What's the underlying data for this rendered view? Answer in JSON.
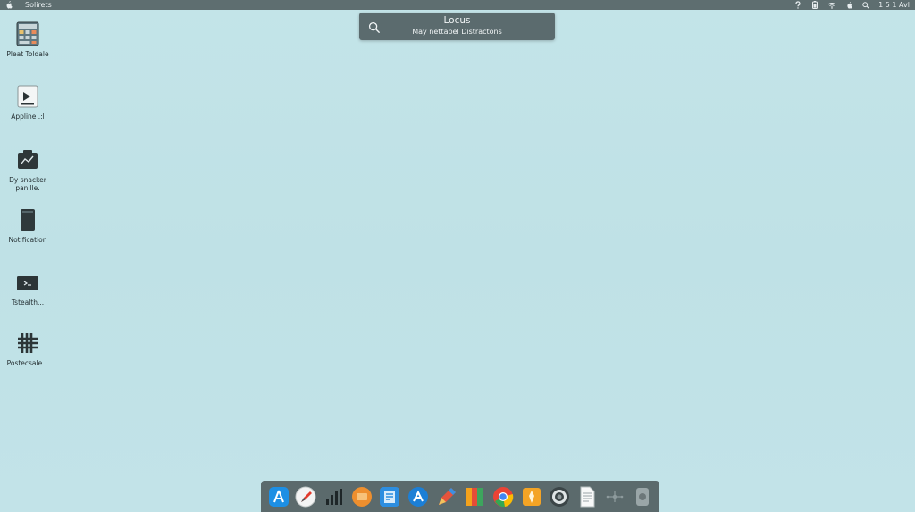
{
  "menubar": {
    "app_name": "Solirets",
    "clock": "1 5 1 Avl",
    "icons": [
      "apple-icon",
      "help-icon",
      "battery-icon",
      "wifi-icon",
      "apple-icon",
      "spotlight-icon"
    ]
  },
  "focus": {
    "title": "Locus",
    "subtitle": "May nettapel Distractons"
  },
  "desktop_icons": [
    {
      "icon": "calculator-icon",
      "label": "Pleat Toldale"
    },
    {
      "icon": "app-icon",
      "label": "Appline .:l"
    },
    {
      "icon": "dashboard-icon",
      "label": "Dy snacker panille."
    },
    {
      "icon": "notification-icon",
      "label": "Notification"
    },
    {
      "icon": "terminal-icon",
      "label": "Tstealth..."
    },
    {
      "icon": "grid-icon",
      "label": "Postecsale..."
    }
  ],
  "dock": [
    {
      "icon": "app-store-icon"
    },
    {
      "icon": "safari-icon"
    },
    {
      "icon": "activity-monitor-icon"
    },
    {
      "icon": "books-icon"
    },
    {
      "icon": "finder-icon"
    },
    {
      "icon": "xcode-icon"
    },
    {
      "icon": "pencil-icon"
    },
    {
      "icon": "notes-icon"
    },
    {
      "icon": "chrome-icon"
    },
    {
      "icon": "sketch-icon"
    },
    {
      "icon": "camera-icon"
    },
    {
      "icon": "document-icon"
    },
    {
      "icon": "network-icon"
    },
    {
      "icon": "disk-icon"
    }
  ],
  "colors": {
    "desktop": "#c1e3e7",
    "menubar": "#5e6e70",
    "widget": "#5b6b6e",
    "dock": "#5b6a6c"
  }
}
